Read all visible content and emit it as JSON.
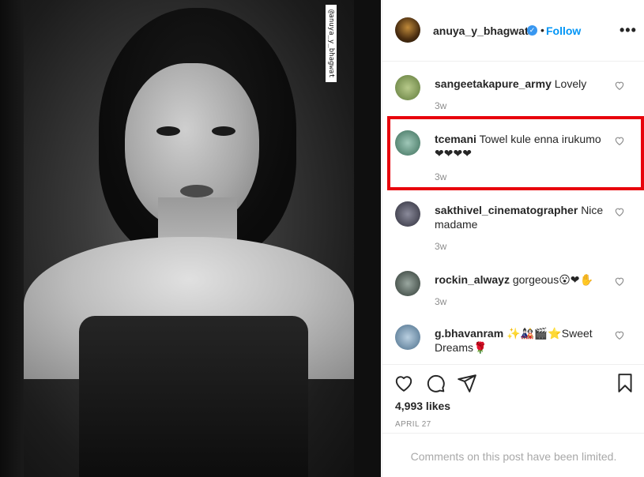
{
  "post": {
    "watermark": "@anuya_y_bhagwat",
    "author": "anuya_y_bhagwat",
    "follow_label": "Follow",
    "separator": "•",
    "more_glyph": "•••",
    "verified_glyph": "✓"
  },
  "comments": [
    {
      "user": "sangeetakapure_army",
      "text": "Lovely",
      "time": "3w"
    },
    {
      "user": "tcemani",
      "text": "Towel kule enna irukumo ❤❤❤❤",
      "time": "3w"
    },
    {
      "user": "sakthivel_cinematographer",
      "text": "Nice madame",
      "time": "3w"
    },
    {
      "user": "rockin_alwayz",
      "text": "gorgeous😮❤✋",
      "time": "3w"
    },
    {
      "user": "g.bhavanram",
      "text": "✨🎎🎬⭐Sweet Dreams🌹",
      "time": ""
    }
  ],
  "engagement": {
    "likes": "4,993 likes",
    "date": "APRIL 27"
  },
  "footer": {
    "limited_text": "Comments on this post have been limited."
  },
  "colors": {
    "follow": "#0095f6",
    "highlight": "#e8040c",
    "verified": "#3897f0"
  }
}
